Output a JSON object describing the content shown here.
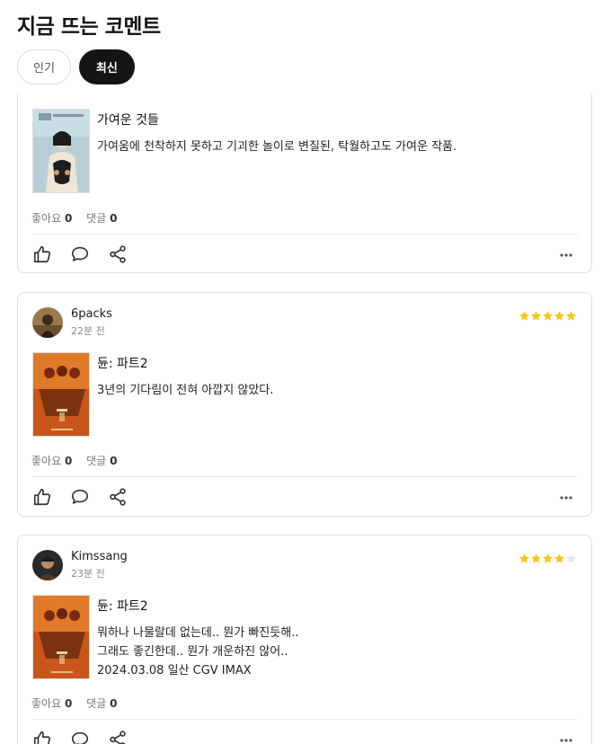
{
  "header": {
    "title": "지금 뜨는 코멘트"
  },
  "tabs": [
    {
      "label": "인기",
      "active": false
    },
    {
      "label": "최신",
      "active": true
    }
  ],
  "comments": [
    {
      "username": "",
      "time": "",
      "rating": null,
      "movie_title": "가여운 것들",
      "lines": [
        "가여움에 천착하지 못하고 기괴한 놀이로 변질된, 탁월하고도 가여운 작품."
      ],
      "likes_label": "좋아요",
      "likes": "0",
      "replies_label": "댓글",
      "replies": "0"
    },
    {
      "username": "6packs",
      "time": "22분 전",
      "rating": 5,
      "movie_title": "듄: 파트2",
      "lines": [
        "3년의 기다림이 전혀 아깝지 않았다."
      ],
      "likes_label": "좋아요",
      "likes": "0",
      "replies_label": "댓글",
      "replies": "0"
    },
    {
      "username": "Kimssang",
      "time": "23분 전",
      "rating": 4,
      "movie_title": "듄: 파트2",
      "lines": [
        "뭐하나 나물랄데 없는데.. 뭔가 빠진듯해..",
        "그래도 좋긴한데.. 뭔가 개운하진 않어..",
        "2024.03.08 일산 CGV IMAX"
      ],
      "likes_label": "좋아요",
      "likes": "0",
      "replies_label": "댓글",
      "replies": "0"
    }
  ],
  "colors": {
    "star": "#f5c518",
    "star_empty": "#e6e6e6",
    "active_tab": "#141414"
  },
  "icons": [
    "thumbs-up-icon",
    "comment-bubble-icon",
    "share-icon",
    "more-icon"
  ]
}
